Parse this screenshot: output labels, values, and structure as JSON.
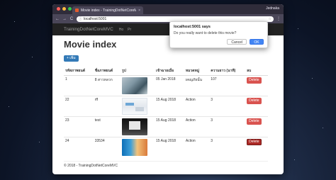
{
  "browser": {
    "tab_title": "Movie index - TrainingDotNetCoreMVC",
    "tab_close": "×",
    "profile_name": "Jednaka",
    "url": "localhost:5001",
    "back_icon": "←",
    "forward_icon": "→",
    "reload_icon": "C",
    "info_icon": "ⓘ",
    "star_icon": "☆",
    "menu_icon": "⋮"
  },
  "navbar": {
    "brand": "TrainingDotNetCoreMVC",
    "links": [
      "Ho",
      "Pr"
    ]
  },
  "page": {
    "title": "Movie index",
    "create_label": "+ เพิ่ม"
  },
  "table": {
    "headers": [
      "รหัสภาพยนต์",
      "ชื่อภาพยนต์",
      "รูป",
      "เข้าฉายเมื่อ",
      "หมวดหมู่",
      "ความยาว (นาที)",
      "ลบ"
    ],
    "rows": [
      {
        "id": "1",
        "name": "8 สาวหลวก",
        "date": "05 Jan 2018",
        "genre": "ผจญภัยนั้น",
        "length": "107",
        "delete_label": "Delete"
      },
      {
        "id": "22",
        "name": "rff",
        "date": "15 Aug 2018",
        "genre": "Action",
        "length": "3",
        "delete_label": "Delete"
      },
      {
        "id": "23",
        "name": "test",
        "date": "15 Aug 2018",
        "genre": "Action",
        "length": "3",
        "delete_label": "Delete"
      },
      {
        "id": "24",
        "name": "33534",
        "date": "15 Aug 2018",
        "genre": "Action",
        "length": "3",
        "delete_label": "Delete"
      }
    ]
  },
  "footer": {
    "text": "© 2018 - TrainingDotNetCoreMVC"
  },
  "dialog": {
    "origin": "localhost:5001 says",
    "message": "Do you really want to delete this movie?",
    "cancel_label": "Cancel",
    "ok_label": "OK"
  },
  "colors": {
    "primary": "#337ab7",
    "danger": "#d9534f",
    "dialog_ok": "#4285f4",
    "navbar": "#222222"
  }
}
